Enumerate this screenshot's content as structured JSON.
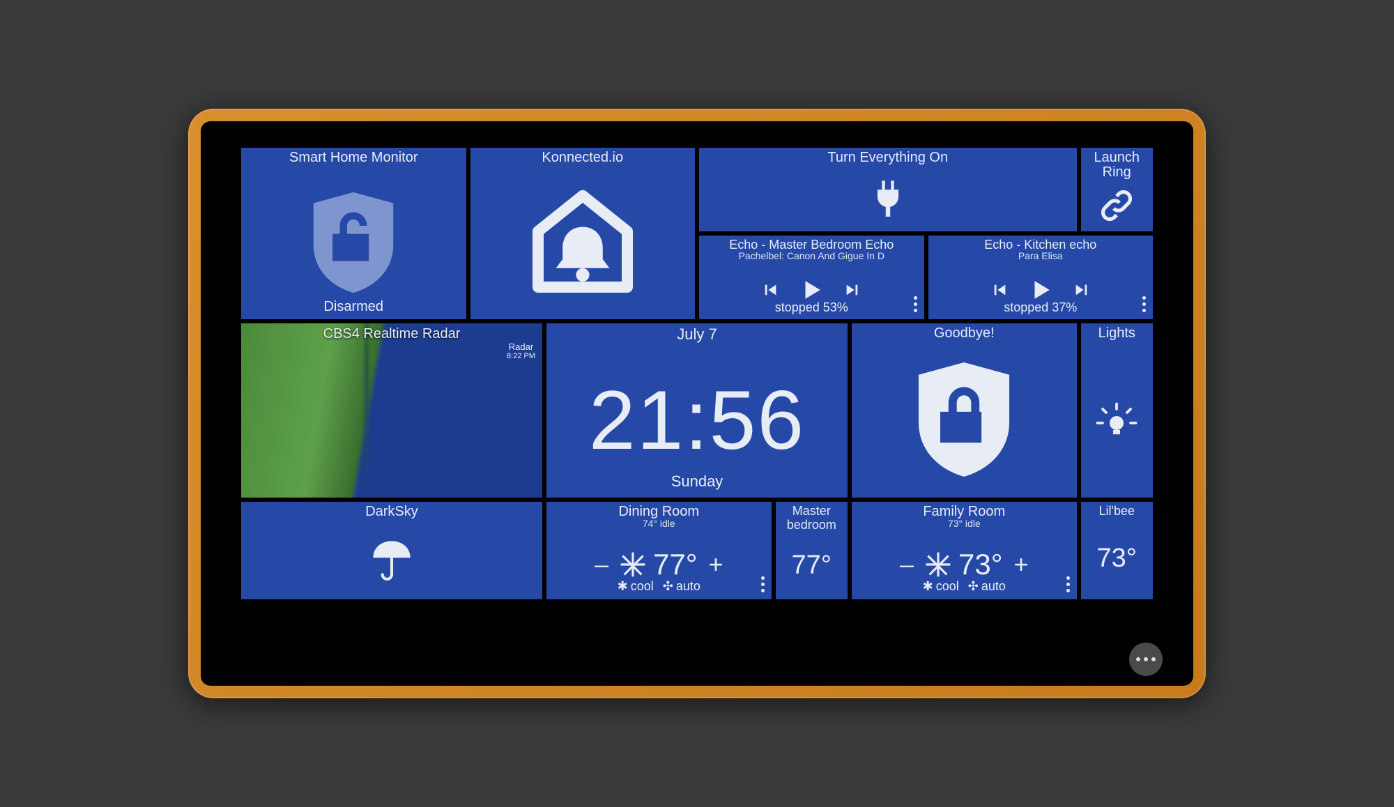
{
  "shm": {
    "title": "Smart Home Monitor",
    "status": "Disarmed"
  },
  "konnected": {
    "title": "Konnected.io"
  },
  "everything": {
    "title": "Turn Everything On"
  },
  "ring": {
    "title": "Launch Ring"
  },
  "echo1": {
    "title": "Echo - Master Bedroom Echo",
    "track": "Pachelbel: Canon And Gigue In D",
    "status": "stopped 53%"
  },
  "echo2": {
    "title": "Echo - Kitchen echo",
    "track": "Para Elisa",
    "status": "stopped 37%"
  },
  "radar": {
    "title": "CBS4 Realtime Radar",
    "overlay_label": "Radar",
    "overlay_time": "8:22 PM"
  },
  "clock": {
    "date": "July 7",
    "time": "21:56",
    "day": "Sunday"
  },
  "goodbye": {
    "title": "Goodbye!"
  },
  "lights": {
    "title": "Lights"
  },
  "darksky": {
    "title": "DarkSky"
  },
  "dining": {
    "title": "Dining Room",
    "sub": "74° idle",
    "temp": "77°",
    "mode1": "cool",
    "mode2": "auto",
    "minus": "–",
    "plus": "+"
  },
  "mbed": {
    "title": "Master bedroom",
    "temp": "77°"
  },
  "family": {
    "title": "Family Room",
    "sub": "73° idle",
    "temp": "73°",
    "mode1": "cool",
    "mode2": "auto",
    "minus": "–",
    "plus": "+"
  },
  "lilbee": {
    "title": "Lil'bee",
    "temp": "73°"
  }
}
